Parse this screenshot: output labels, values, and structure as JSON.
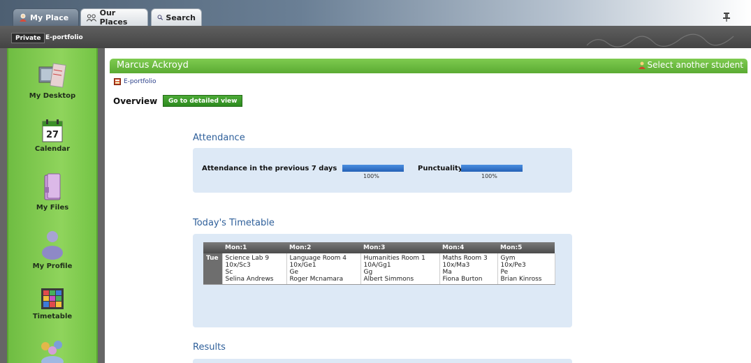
{
  "tabs": {
    "my_place": "My Place",
    "our_places": "Our Places",
    "search": "Search"
  },
  "subnav": {
    "private": "Private",
    "eportfolio": "E-portfolio"
  },
  "sidebar": {
    "items": [
      {
        "label": "My Desktop",
        "icon": "desktop-icon"
      },
      {
        "label": "Calendar",
        "icon": "calendar-icon",
        "day": "27"
      },
      {
        "label": "My Files",
        "icon": "files-icon"
      },
      {
        "label": "My Profile",
        "icon": "profile-icon"
      },
      {
        "label": "Timetable",
        "icon": "timetable-icon"
      },
      {
        "label": "",
        "icon": "people-icon"
      }
    ]
  },
  "header": {
    "student_name": "Marcus Ackroyd",
    "select_student": "Select another student"
  },
  "breadcrumb": "E-portfolio",
  "overview": {
    "label": "Overview",
    "detail_button": "Go to detailed view"
  },
  "attendance": {
    "title": "Attendance",
    "previous_label": "Attendance in the previous 7 days",
    "previous_value": "100%",
    "previous_fill": 1.0,
    "punctuality_label": "Punctuality",
    "punctuality_value": "100%",
    "punctuality_fill": 1.0
  },
  "timetable": {
    "title": "Today's Timetable",
    "headers": [
      "",
      "Mon:1",
      "Mon:2",
      "Mon:3",
      "Mon:4",
      "Mon:5"
    ],
    "day": "Tue",
    "cells": [
      [
        "Science Lab 9",
        "10x/Sc3",
        "Sc",
        "Selina Andrews"
      ],
      [
        "Language Room 4",
        "10x/Ge1",
        "Ge",
        "Roger Mcnamara"
      ],
      [
        "Humanities Room 1",
        "10A/Gg1",
        "Gg",
        "Albert Simmons"
      ],
      [
        "Maths Room 3",
        "10x/Ma3",
        "Ma",
        "Fiona Burton"
      ],
      [
        "Gym",
        "10x/Pe3",
        "Pe",
        "Brian Kinross"
      ]
    ]
  },
  "results": {
    "title": "Results"
  },
  "colors": {
    "green_header": "#5bab33",
    "sidebar_green": "#8fd45c",
    "panel_blue": "#dde9f6",
    "title_blue": "#2e5f9a",
    "bar_blue": "#2461b6"
  }
}
